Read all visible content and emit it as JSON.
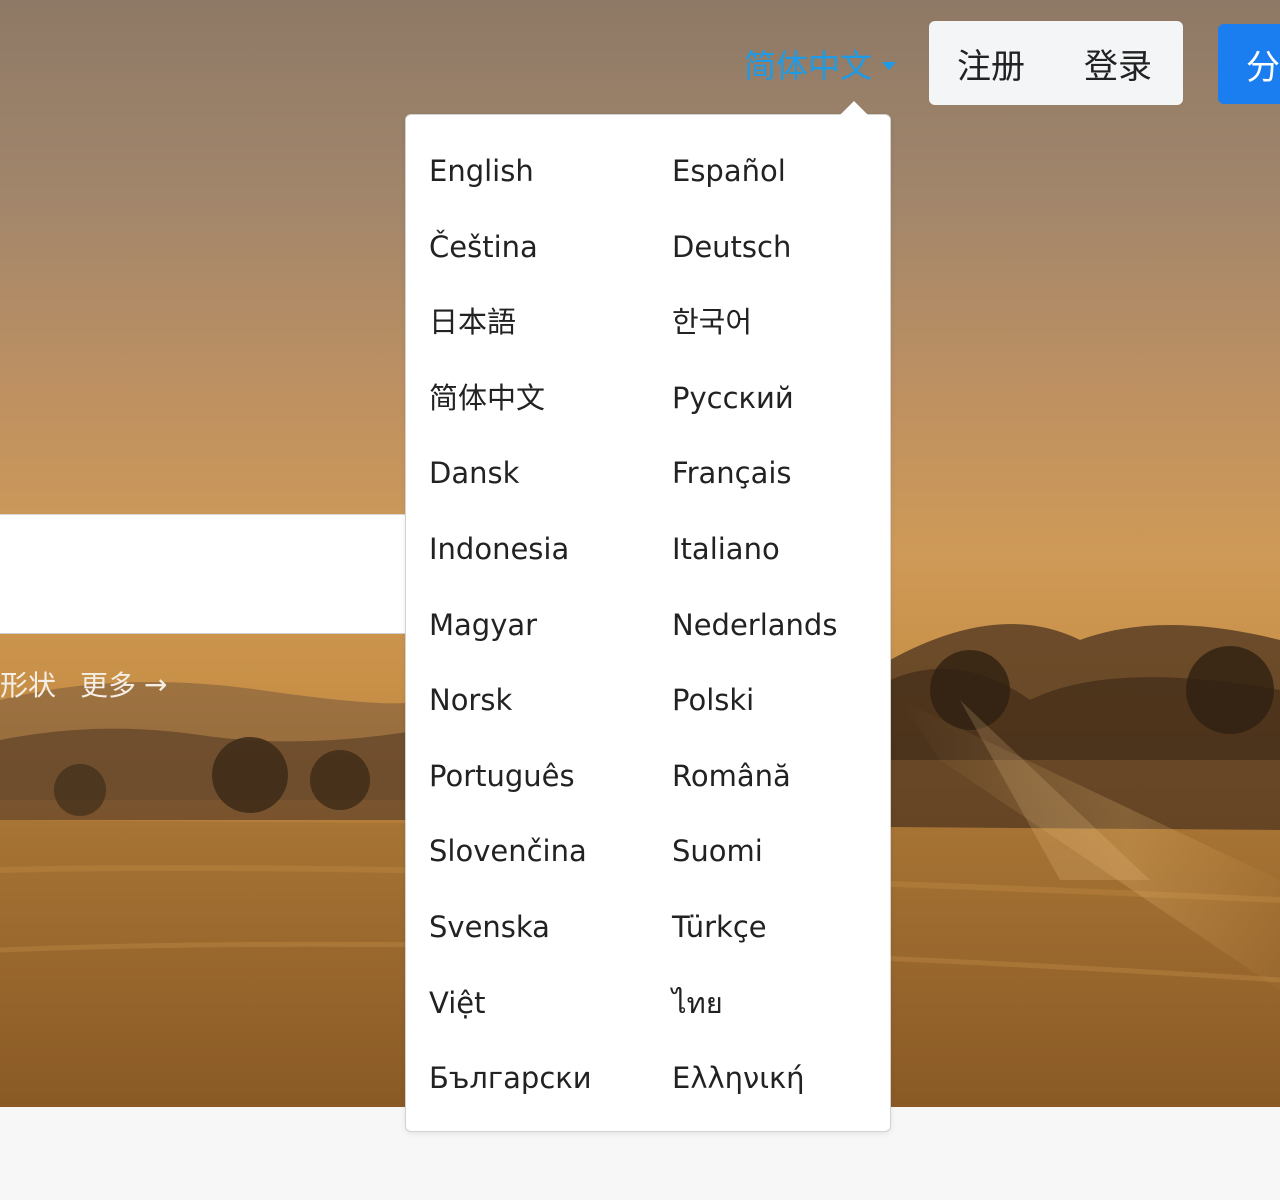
{
  "header": {
    "language_current": "简体中文",
    "signup_label": "注册",
    "login_label": "登录",
    "share_label": "分"
  },
  "hero": {
    "tags": {
      "shapes_label": "形状",
      "more_label": "更多",
      "more_arrow": "→"
    }
  },
  "language_menu": {
    "items": [
      "English",
      "Español",
      "Čeština",
      "Deutsch",
      "日本語",
      "한국어",
      "简体中文",
      "Русский",
      "Dansk",
      "Français",
      "Indonesia",
      "Italiano",
      "Magyar",
      "Nederlands",
      "Norsk",
      "Polski",
      "Português",
      "Română",
      "Slovenčina",
      "Suomi",
      "Svenska",
      "Türkçe",
      "Việt",
      "ไทย",
      "Български",
      "Ελληνική"
    ]
  },
  "colors": {
    "accent": "#1e9be6",
    "primary_button": "#1a7ef0"
  }
}
